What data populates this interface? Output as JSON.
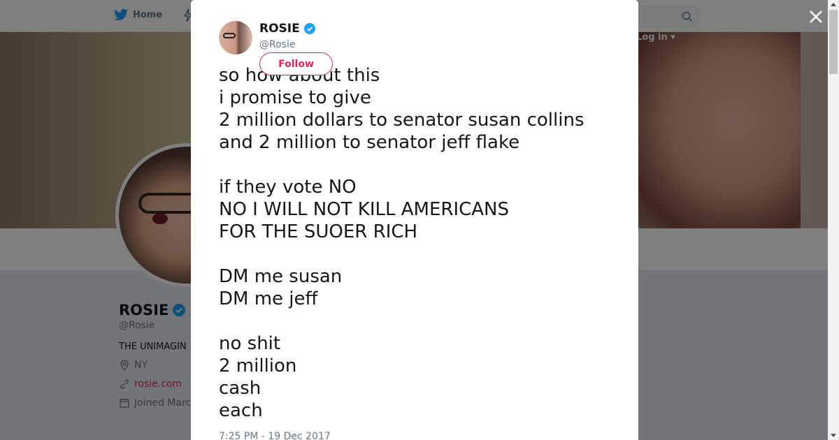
{
  "nav": {
    "home_label": "Home",
    "login_label": "Log in"
  },
  "profile": {
    "name": "ROSIE",
    "handle": "@Rosie",
    "bio_truncated": "THE UNIMAGIN",
    "location": "NY",
    "website": "rosie.com",
    "joined_truncated": "Joined Marc"
  },
  "tweet": {
    "author_name": "ROSIE",
    "author_handle": "@Rosie",
    "follow_label": "Follow",
    "lines": [
      "so how about this",
      "i promise to give",
      "2 million dollars to senator susan collins",
      "and 2 million to senator jeff flake",
      "",
      "if they vote NO",
      "NO I WILL NOT KILL AMERICANS",
      "FOR THE SUOER RICH",
      "",
      "DM me susan",
      "DM me jeff",
      "",
      "no shit",
      "2 million",
      "cash",
      "each"
    ],
    "timestamp": "7:25 PM - 19 Dec 2017"
  },
  "colors": {
    "accent": "#e0245e",
    "verified": "#1da1f2",
    "twitter_blue": "#1da1f2"
  },
  "icons": {
    "close": "close-icon",
    "verified": "verified-badge-icon",
    "bird": "twitter-bird-icon"
  }
}
